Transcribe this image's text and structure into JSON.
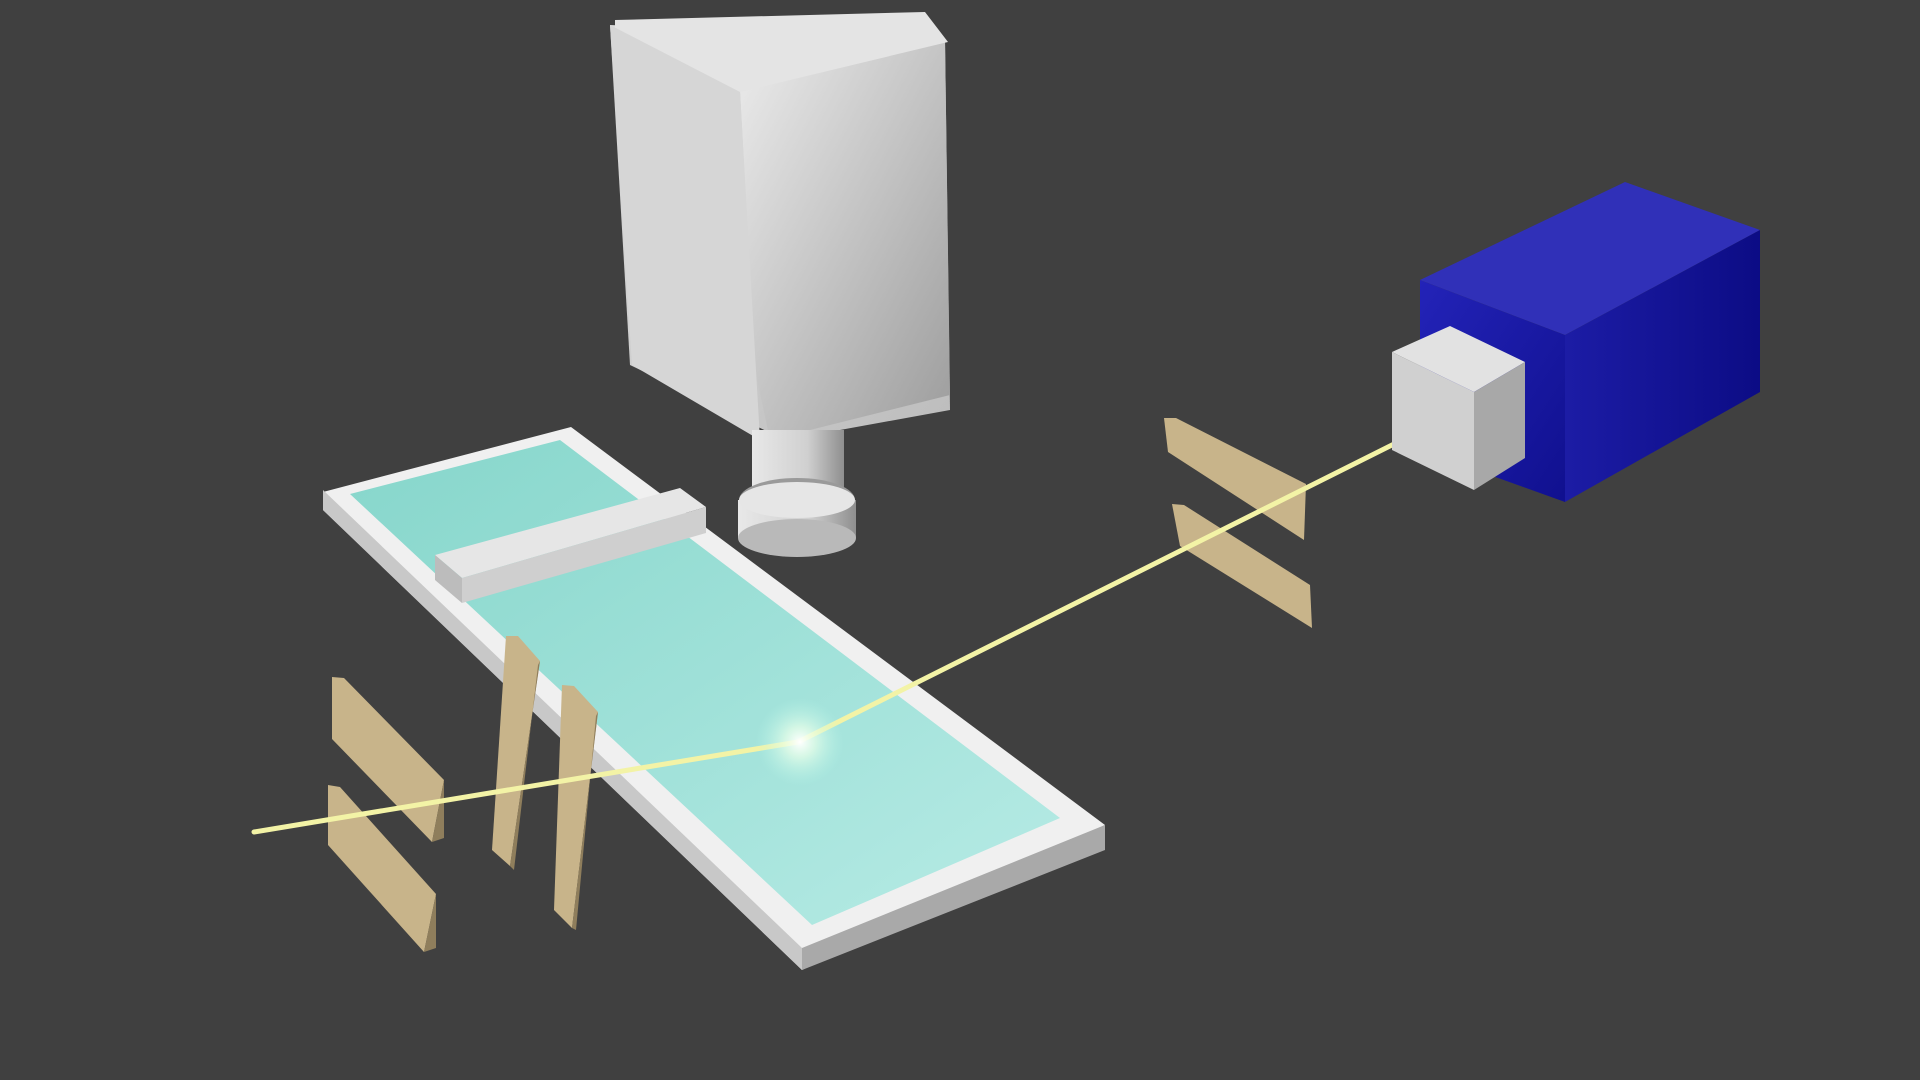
{
  "scene": {
    "background_color": "#404040",
    "beam_color": "#f3f3a6",
    "liquid_color": "#9fe0d8",
    "trough_color": "#d9d9d9",
    "slit_color": "#c8b48a",
    "source_color": "#1a1aa8",
    "detector_color": "#cfcfcf",
    "components": [
      {
        "key": "detector",
        "icon": "box-icon"
      },
      {
        "key": "trough",
        "icon": "tray-icon"
      },
      {
        "key": "barrier",
        "icon": "bar-icon"
      },
      {
        "key": "slits",
        "icon": "slit-icon"
      },
      {
        "key": "source",
        "icon": "box-icon"
      },
      {
        "key": "beam",
        "icon": "ray-icon"
      }
    ]
  }
}
